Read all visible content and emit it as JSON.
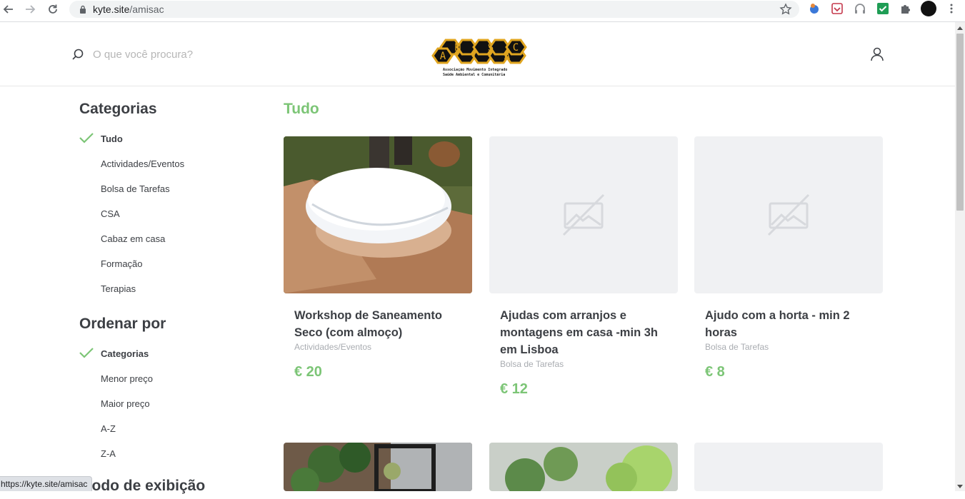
{
  "browser": {
    "url_host": "kyte.site",
    "url_path": "/amisac",
    "status_url": "https://kyte.site/amisac"
  },
  "header": {
    "search_placeholder": "O que você procura?",
    "logo": {
      "letters": [
        "A",
        "M",
        "I",
        "S",
        "A",
        "C"
      ],
      "line1": "Associação Movimento Integrado",
      "line2": "Saúde Ambiental e Comunitária"
    }
  },
  "sidebar": {
    "categories_heading": "Categorias",
    "categories": [
      {
        "label": "Tudo",
        "active": true
      },
      {
        "label": "Actividades/Eventos",
        "active": false
      },
      {
        "label": "Bolsa de Tarefas",
        "active": false
      },
      {
        "label": "CSA",
        "active": false
      },
      {
        "label": "Cabaz em casa",
        "active": false
      },
      {
        "label": "Formação",
        "active": false
      },
      {
        "label": "Terapias",
        "active": false
      }
    ],
    "sort_heading": "Ordenar por",
    "sort_options": [
      {
        "label": "Categorias",
        "active": true
      },
      {
        "label": "Menor preço",
        "active": false
      },
      {
        "label": "Maior preço",
        "active": false
      },
      {
        "label": "A-Z",
        "active": false
      },
      {
        "label": "Z-A",
        "active": false
      }
    ],
    "view_heading": "Modo de exibição"
  },
  "main": {
    "title": "Tudo",
    "products": [
      {
        "name": "Workshop de Saneamento Seco (com almoço)",
        "category": "Actividades/Eventos",
        "price": "€ 20",
        "image": "toilet-seat-photo"
      },
      {
        "name": "Ajudas com arranjos e montagens em casa -min 3h em Lisboa",
        "category": "Bolsa de Tarefas",
        "price": "€ 12",
        "image": "placeholder"
      },
      {
        "name": "Ajudo com a horta - min 2 horas",
        "category": "Bolsa de Tarefas",
        "price": "€ 8",
        "image": "placeholder"
      },
      {
        "name": "",
        "category": "",
        "price": "",
        "image": "kale-crate-photo"
      },
      {
        "name": "",
        "category": "",
        "price": "",
        "image": "greens-photo"
      },
      {
        "name": "",
        "category": "",
        "price": "",
        "image": "placeholder"
      }
    ]
  },
  "colors": {
    "accent_green": "#7cc576",
    "text_dark": "#3c3f44",
    "text_muted": "#a9acb1",
    "placeholder_bg": "#f0f1f3"
  }
}
